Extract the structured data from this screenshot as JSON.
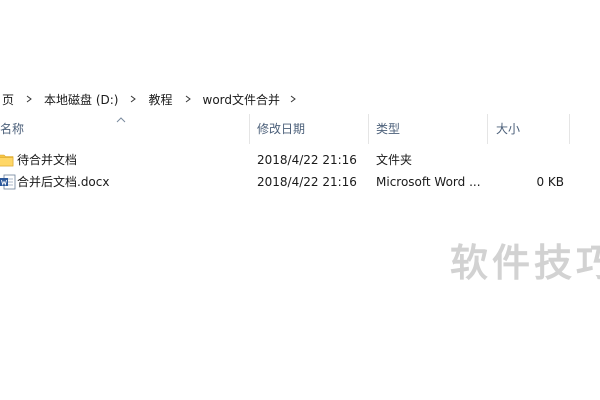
{
  "breadcrumb": {
    "root_partial": "页",
    "drive": "本地磁盘 (D:)",
    "folder1": "教程",
    "folder2": "word文件合并"
  },
  "columns": {
    "name": "名称",
    "date": "修改日期",
    "type": "类型",
    "size": "大小"
  },
  "files": [
    {
      "name": "待合并文档",
      "date": "2018/4/22 21:16",
      "type": "文件夹",
      "size": "",
      "icon": "folder-icon"
    },
    {
      "name": "合并后文档.docx",
      "date": "2018/4/22 21:16",
      "type": "Microsoft Word ...",
      "size": "0 KB",
      "icon": "word-document-icon"
    }
  ],
  "watermark": "软件技巧",
  "colors": {
    "header_text": "#4c607a",
    "folder": "#f6c544",
    "word_blue": "#2b579a"
  }
}
